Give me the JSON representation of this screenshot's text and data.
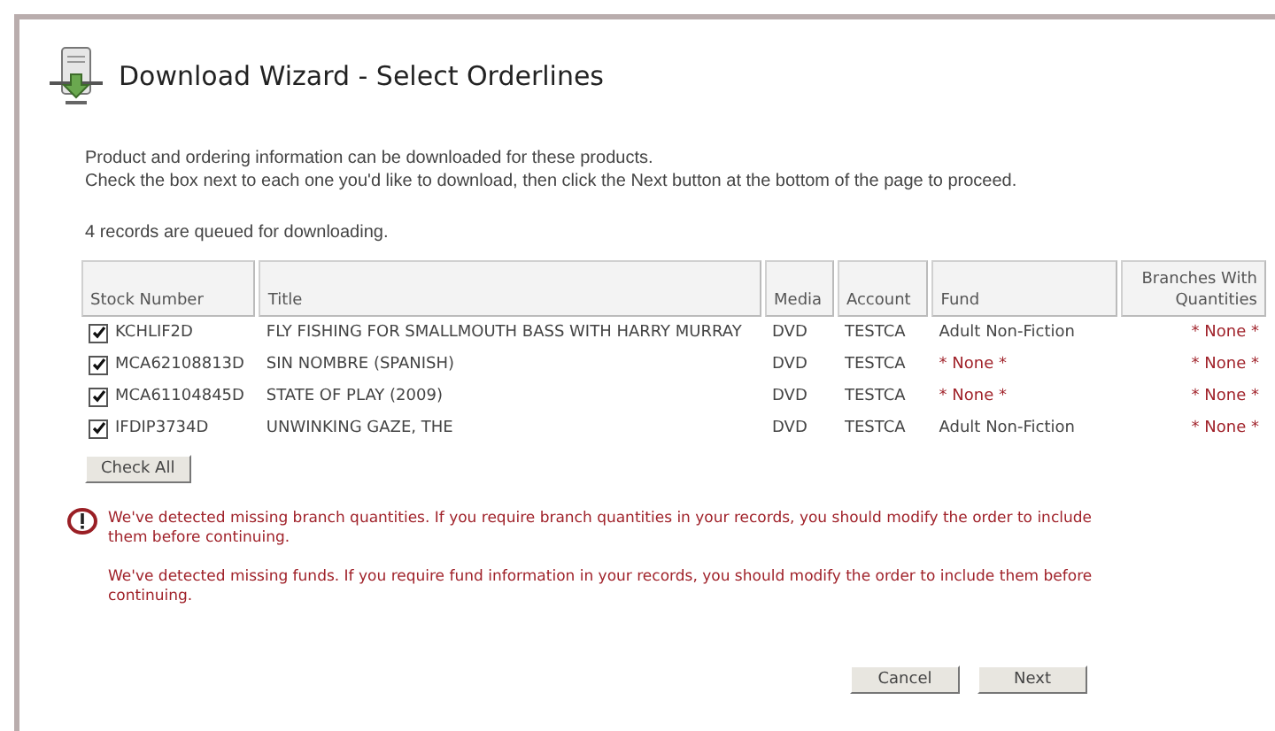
{
  "title": "Download Wizard - Select Orderlines",
  "intro": [
    "Product and ordering information can be downloaded for these products.",
    "Check the box next to each one you'd like to download, then click the Next button at the bottom of the page to proceed."
  ],
  "queued": "4 records are queued for downloading.",
  "table": {
    "columns": [
      "Stock Number",
      "Title",
      "Media",
      "Account",
      "Fund",
      "Branches With Quantities"
    ],
    "rows": [
      {
        "checked": true,
        "stock": "KCHLIF2D",
        "title": "FLY FISHING FOR SMALLMOUTH BASS WITH HARRY MURRAY",
        "media": "DVD",
        "account": "TESTCA",
        "fund": {
          "text": "Adult Non-Fiction",
          "missing": false
        },
        "branches": {
          "text": "* None *",
          "missing": true
        }
      },
      {
        "checked": true,
        "stock": "MCA62108813D",
        "title": "SIN NOMBRE (SPANISH)",
        "media": "DVD",
        "account": "TESTCA",
        "fund": {
          "text": "* None *",
          "missing": true
        },
        "branches": {
          "text": "* None *",
          "missing": true
        }
      },
      {
        "checked": true,
        "stock": "MCA61104845D",
        "title": "STATE OF PLAY (2009)",
        "media": "DVD",
        "account": "TESTCA",
        "fund": {
          "text": "* None *",
          "missing": true
        },
        "branches": {
          "text": "* None *",
          "missing": true
        }
      },
      {
        "checked": true,
        "stock": "IFDIP3734D",
        "title": "UNWINKING GAZE, THE",
        "media": "DVD",
        "account": "TESTCA",
        "fund": {
          "text": "Adult Non-Fiction",
          "missing": false
        },
        "branches": {
          "text": "* None *",
          "missing": true
        }
      }
    ]
  },
  "check_all": "Check All",
  "warnings": [
    "We've detected missing branch quantities. If you require branch quantities in your records, you should modify the order to include them before continuing.",
    "We've detected missing funds. If you require fund information in your records, you should modify the order to include them before continuing."
  ],
  "buttons": [
    "Cancel",
    "Next"
  ]
}
